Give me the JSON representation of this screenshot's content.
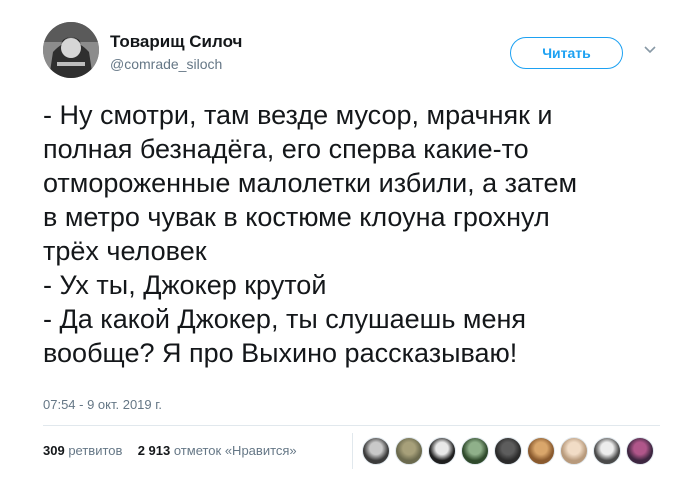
{
  "author": {
    "display_name": "Товарищ Силоч",
    "handle": "@comrade_siloch",
    "avatar": "grayscale-portrait-avatar"
  },
  "follow_button": {
    "label": "Читать"
  },
  "caret": {
    "icon": "chevron-down-icon"
  },
  "tweet": {
    "lines": [
      "- Ну смотри, там везде мусор, мрачняк и",
      "полная безнадёга, его сперва какие-то",
      "отмороженные малолетки избили, а затем",
      "в метро чувак в костюме клоуна грохнул",
      "трёх человек",
      "- Ух ты, Джокер крутой",
      "- Да какой Джокер, ты слушаешь меня",
      "вообще? Я про Выхино рассказываю!"
    ],
    "timestamp": "07:54 - 9 окт. 2019 г."
  },
  "stats": {
    "retweets_count": "309",
    "retweets_label": "ретвитов",
    "likes_count": "2 913",
    "likes_label": "отметок «Нравится»"
  },
  "liker_avatars": [
    {
      "name": "liker-avatar-1",
      "color": "#3b3b3b",
      "accent": "#c9c9c9"
    },
    {
      "name": "liker-avatar-2",
      "color": "#6b6a4e",
      "accent": "#a7a07a"
    },
    {
      "name": "liker-avatar-3",
      "color": "#1f1f1f",
      "accent": "#e8e8e8"
    },
    {
      "name": "liker-avatar-4",
      "color": "#2f4a2c",
      "accent": "#8fb08a"
    },
    {
      "name": "liker-avatar-5",
      "color": "#2b2b2b",
      "accent": "#5d5d5d"
    },
    {
      "name": "liker-avatar-6",
      "color": "#8a5a2e",
      "accent": "#d9a66b"
    },
    {
      "name": "liker-avatar-7",
      "color": "#b89a7c",
      "accent": "#f1dcc6"
    },
    {
      "name": "liker-avatar-8",
      "color": "#4a4a4a",
      "accent": "#ededed"
    },
    {
      "name": "liker-avatar-9",
      "color": "#3d2640",
      "accent": "#b0568a"
    }
  ]
}
